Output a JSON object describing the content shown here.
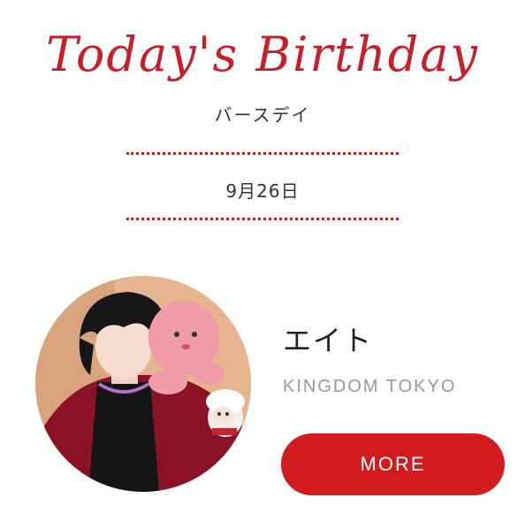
{
  "heading": {
    "script_title": "Today's Birthday",
    "subtitle": "バースデイ",
    "date": "9月26日"
  },
  "profile": {
    "name": "エイト",
    "shop": "KINGDOM TOKYO",
    "more_label": "MORE",
    "avatar_icon": "profile-photo"
  },
  "colors": {
    "accent": "#d21b1f",
    "dots": "#b3262b",
    "script_title": "#c8202a",
    "shop_text": "#999999"
  }
}
